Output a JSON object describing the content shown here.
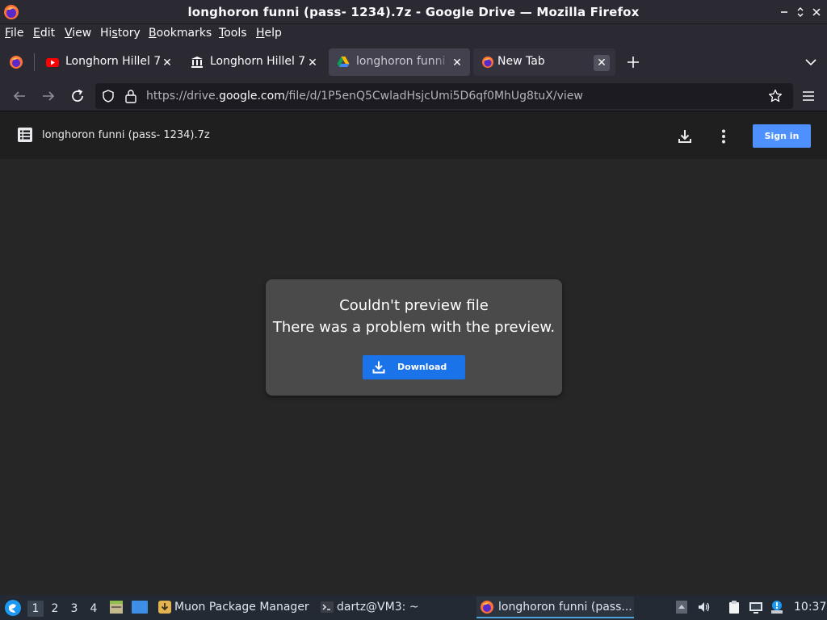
{
  "window": {
    "title": "longhoron funni (pass- 1234).7z - Google Drive — Mozilla Firefox",
    "controls": [
      "minimize",
      "restore",
      "close"
    ]
  },
  "menubar": {
    "items": [
      {
        "label": "File",
        "mnemonic": "F"
      },
      {
        "label": "Edit",
        "mnemonic": "E"
      },
      {
        "label": "View",
        "mnemonic": "V"
      },
      {
        "label": "History",
        "mnemonic": "s"
      },
      {
        "label": "Bookmarks",
        "mnemonic": "B"
      },
      {
        "label": "Tools",
        "mnemonic": "T"
      },
      {
        "label": "Help",
        "mnemonic": "H"
      }
    ]
  },
  "tabs": [
    {
      "label": "Longhorn Hillel 7 (",
      "icon": "youtube-icon",
      "active": false
    },
    {
      "label": "Longhorn Hillel 7 (",
      "icon": "building-icon",
      "active": false
    },
    {
      "label": "longhoron funni (p",
      "icon": "google-drive-icon",
      "active": true
    },
    {
      "label": "New Tab",
      "icon": "firefox-icon",
      "active": false
    }
  ],
  "navbar": {
    "url_prefix": "https://drive.",
    "url_domain": "google.com",
    "url_path": "/file/d/1P5enQ5CwladHsjcUmi5D6qf0MhUg8tuX/view"
  },
  "drive": {
    "file_name": "longhoron funni (pass- 1234).7z",
    "sign_in_label": "Sign in"
  },
  "preview": {
    "heading": "Couldn't preview file",
    "message": "There was a problem with the preview.",
    "download_label": "Download"
  },
  "taskbar": {
    "workspaces": [
      "1",
      "2",
      "3",
      "4"
    ],
    "active_workspace": "1",
    "tasks": [
      {
        "label": "Muon Package Manager",
        "icon": "package-manager-icon"
      },
      {
        "label": "dartz@VM3: ~",
        "icon": "terminal-icon"
      },
      {
        "label": "longhoron funni (pass...",
        "icon": "firefox-icon",
        "active": true
      }
    ],
    "clock": "10:37"
  },
  "colors": {
    "accent": "#1a73e8",
    "signin": "#4d90fe",
    "chrome_bg": "#2b2a33",
    "content_bg": "#262626"
  }
}
